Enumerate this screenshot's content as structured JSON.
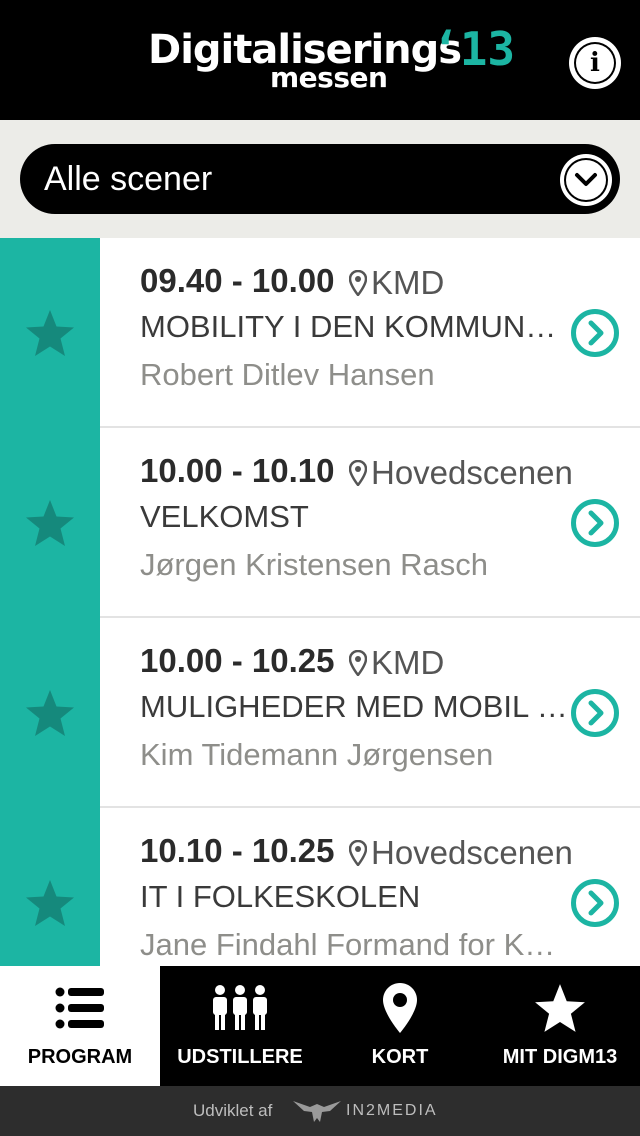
{
  "header": {
    "logo_main": "Digitaliserings",
    "logo_sub": "messen",
    "logo_year": "‘13",
    "info_icon": "info-icon"
  },
  "filter": {
    "selected": "Alle scener",
    "icon": "chevron-down-icon"
  },
  "colors": {
    "accent": "#1cb5a3",
    "header_bg": "#000000",
    "filter_bg": "#ecece8",
    "speaker_text": "#8e8e8a"
  },
  "sessions": [
    {
      "time": "09.40 - 10.00",
      "location": "KMD",
      "title": "MOBILITY I DEN KOMMUNA…",
      "speaker": "Robert Ditlev Hansen"
    },
    {
      "time": "10.00 - 10.10",
      "location": "Hovedscenen",
      "title": "VELKOMST",
      "speaker": "Jørgen Kristensen Rasch"
    },
    {
      "time": "10.00 - 10.25",
      "location": "KMD",
      "title": "MULIGHEDER MED MOBIL …",
      "speaker": "Kim Tidemann Jørgensen"
    },
    {
      "time": "10.10 - 10.25",
      "location": "Hovedscenen",
      "title": "IT I FOLKESKOLEN",
      "speaker": "Jane Findahl Formand for K…"
    }
  ],
  "tabs": [
    {
      "label": "PROGRAM",
      "icon": "list-icon",
      "active": true
    },
    {
      "label": "UDSTILLERE",
      "icon": "people-icon",
      "active": false
    },
    {
      "label": "KORT",
      "icon": "map-pin-icon",
      "active": false
    },
    {
      "label": "MIT DIGM13",
      "icon": "star-icon",
      "active": false
    }
  ],
  "footer": {
    "credit": "Udviklet af",
    "brand": "IN2MEDIA"
  }
}
